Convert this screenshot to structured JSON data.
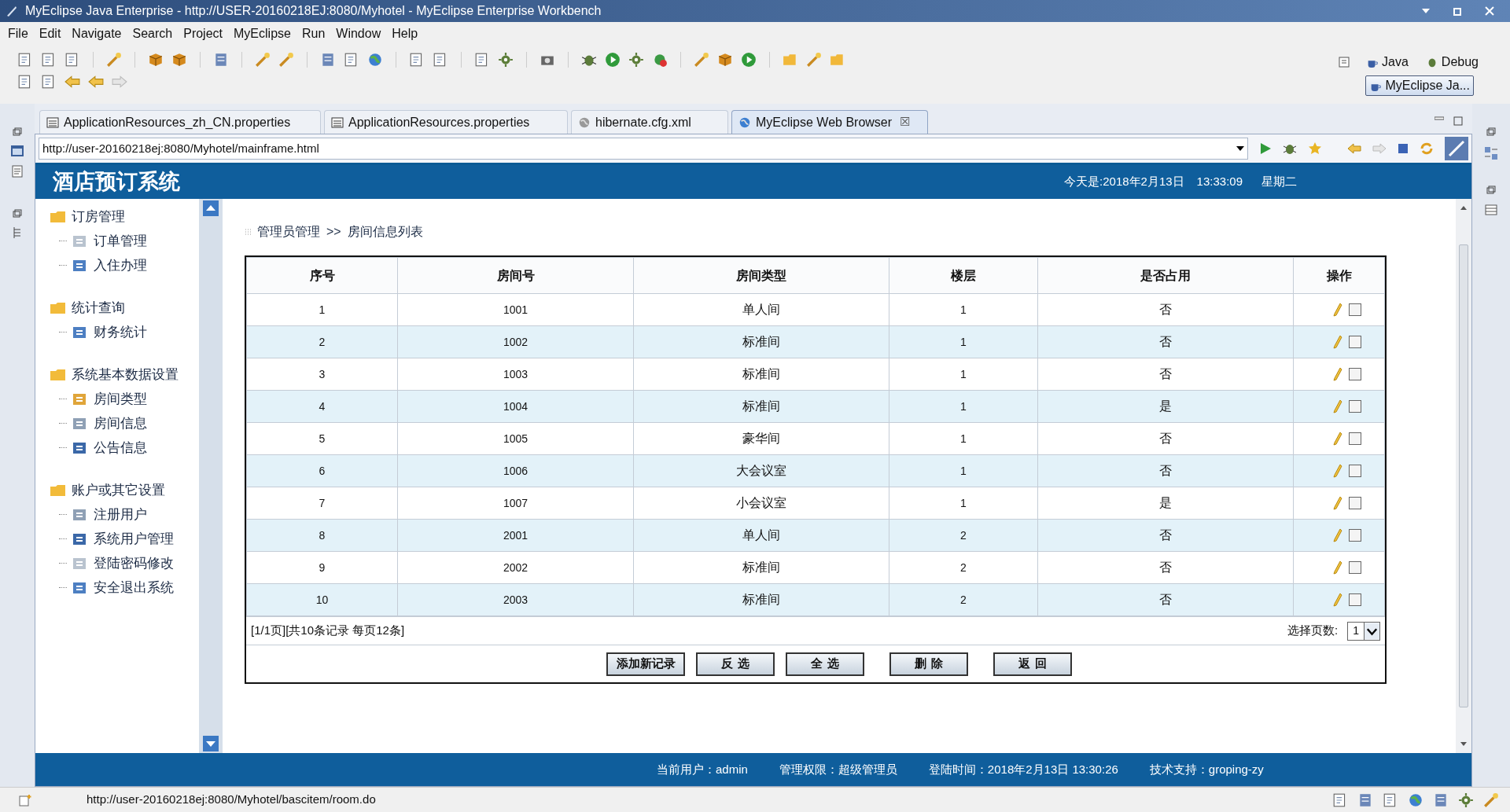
{
  "window": {
    "title": "MyEclipse Java Enterprise - http://USER-20160218EJ:8080/Myhotel - MyEclipse Enterprise Workbench"
  },
  "menu": [
    "File",
    "Edit",
    "Navigate",
    "Search",
    "Project",
    "MyEclipse",
    "Run",
    "Window",
    "Help"
  ],
  "perspectives": [
    {
      "label": "Java",
      "selected": false
    },
    {
      "label": "Debug",
      "selected": false
    },
    {
      "label": "MyEclipse Ja...",
      "selected": true
    }
  ],
  "editor_tabs": [
    {
      "label": "ApplicationResources_zh_CN.properties",
      "selected": false
    },
    {
      "label": "ApplicationResources.properties",
      "selected": false
    },
    {
      "label": "hibernate.cfg.xml",
      "selected": false
    },
    {
      "label": "MyEclipse Web Browser",
      "selected": true,
      "close": "☒"
    }
  ],
  "browser": {
    "address": "http://user-20160218ej:8080/Myhotel/mainframe.html"
  },
  "page": {
    "title": "酒店预订系统",
    "date": "今天是:2018年2月13日",
    "time": "13:33:09",
    "weekday": "星期二",
    "sidebar": [
      {
        "label": "订房管理",
        "children": [
          {
            "label": "订单管理"
          },
          {
            "label": "入住办理"
          }
        ]
      },
      {
        "label": "统计查询",
        "children": [
          {
            "label": "财务统计"
          }
        ]
      },
      {
        "label": "系统基本数据设置",
        "children": [
          {
            "label": "房间类型"
          },
          {
            "label": "房间信息"
          },
          {
            "label": "公告信息"
          }
        ]
      },
      {
        "label": "账户或其它设置",
        "children": [
          {
            "label": "注册用户"
          },
          {
            "label": "系统用户管理"
          },
          {
            "label": "登陆密码修改"
          },
          {
            "label": "安全退出系统"
          }
        ]
      }
    ],
    "breadcrumb": [
      "管理员管理",
      ">>",
      "房间信息列表"
    ],
    "table": {
      "columns": [
        "序号",
        "房间号",
        "房间类型",
        "楼层",
        "是否占用",
        "操作"
      ],
      "rows": [
        {
          "cells": [
            "1",
            "1001",
            "单人间",
            "1",
            "否"
          ],
          "checked": false
        },
        {
          "cells": [
            "2",
            "1002",
            "标准间",
            "1",
            "否"
          ],
          "checked": false
        },
        {
          "cells": [
            "3",
            "1003",
            "标准间",
            "1",
            "否"
          ],
          "checked": false
        },
        {
          "cells": [
            "4",
            "1004",
            "标准间",
            "1",
            "是"
          ],
          "checked": false
        },
        {
          "cells": [
            "5",
            "1005",
            "豪华间",
            "1",
            "否"
          ],
          "checked": false
        },
        {
          "cells": [
            "6",
            "1006",
            "大会议室",
            "1",
            "否"
          ],
          "checked": false
        },
        {
          "cells": [
            "7",
            "1007",
            "小会议室",
            "1",
            "是"
          ],
          "checked": false
        },
        {
          "cells": [
            "8",
            "2001",
            "单人间",
            "2",
            "否"
          ],
          "checked": false
        },
        {
          "cells": [
            "9",
            "2002",
            "标准间",
            "2",
            "否"
          ],
          "checked": false
        },
        {
          "cells": [
            "10",
            "2003",
            "标准间",
            "2",
            "否"
          ],
          "checked": false
        }
      ]
    },
    "pager": {
      "summary": "[1/1页][共10条记录 每页12条]",
      "page_label": "选择页数:",
      "page_value": "1"
    },
    "buttons": [
      "添加新记录",
      "反 选",
      "全 选",
      "删 除",
      "返 回"
    ],
    "footer": [
      "当前用户：admin",
      "管理权限：超级管理员",
      "登陆时间：2018年2月13日 13:30:26",
      "技术支持：groping-zy"
    ]
  },
  "status_bar": {
    "text": "http://user-20160218ej:8080/Myhotel/bascitem/room.do"
  }
}
